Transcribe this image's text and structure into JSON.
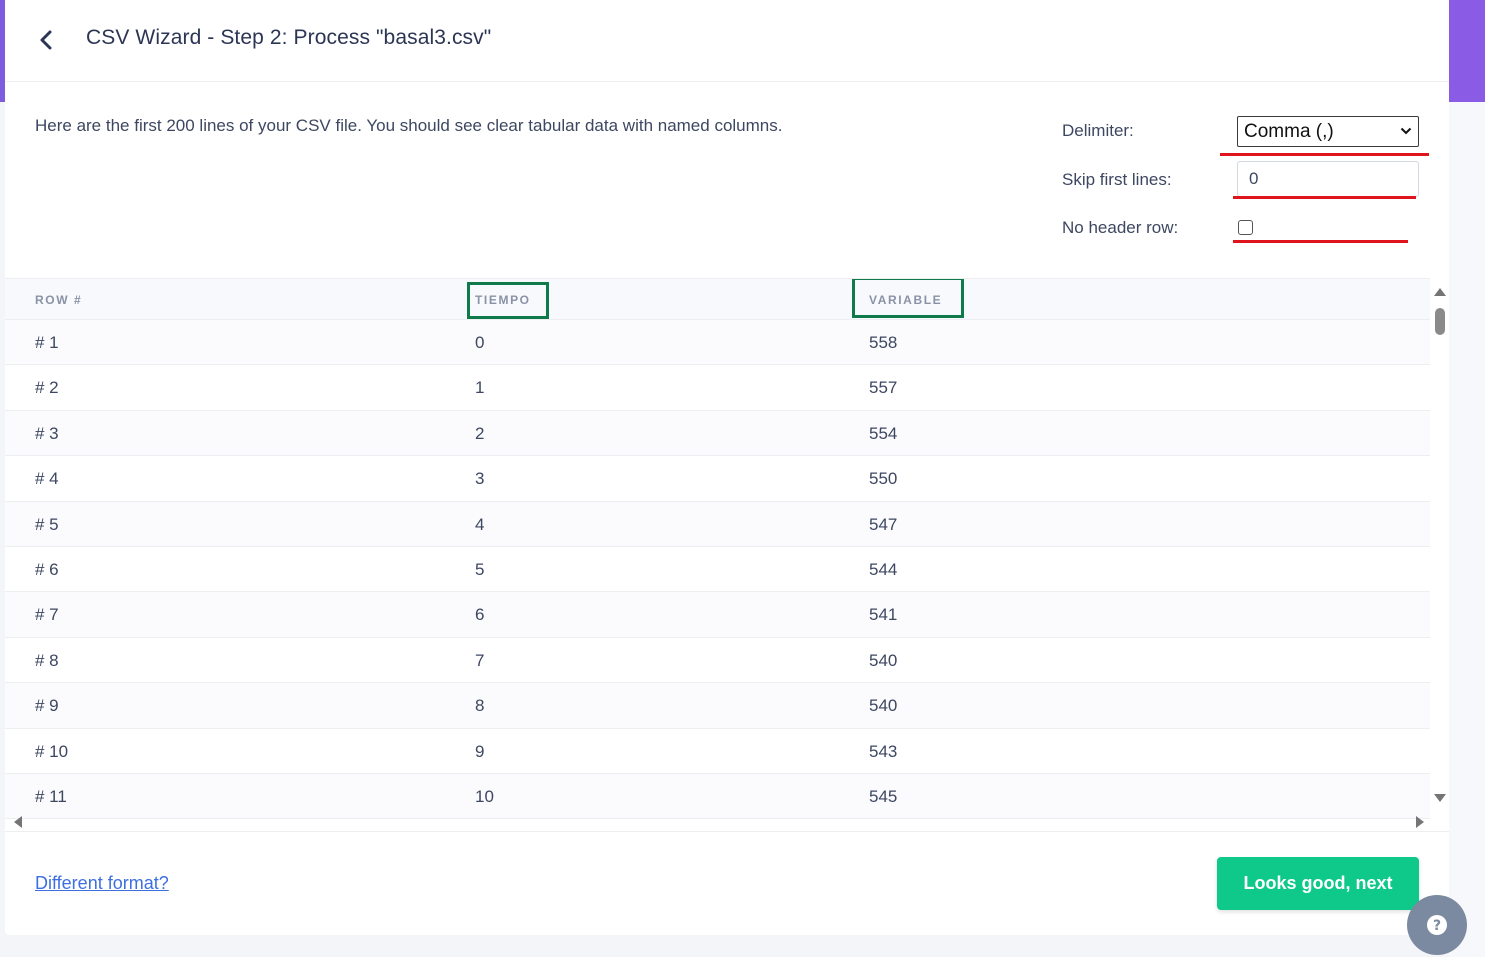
{
  "header": {
    "title": "CSV Wizard - Step 2: Process \"basal3.csv\""
  },
  "intro": "Here are the first 200 lines of your CSV file. You should see clear tabular data with named columns.",
  "options": {
    "delimiter_label": "Delimiter:",
    "delimiter_value": "Comma (,)",
    "skip_label": "Skip first lines:",
    "skip_value": "0",
    "no_header_label": "No header row:",
    "no_header_checked": false
  },
  "table": {
    "columns": [
      "ROW #",
      "TIEMPO",
      "VARIABLE"
    ],
    "rows": [
      [
        "# 1",
        "0",
        "558"
      ],
      [
        "# 2",
        "1",
        "557"
      ],
      [
        "# 3",
        "2",
        "554"
      ],
      [
        "# 4",
        "3",
        "550"
      ],
      [
        "# 5",
        "4",
        "547"
      ],
      [
        "# 6",
        "5",
        "544"
      ],
      [
        "# 7",
        "6",
        "541"
      ],
      [
        "# 8",
        "7",
        "540"
      ],
      [
        "# 9",
        "8",
        "540"
      ],
      [
        "# 10",
        "9",
        "543"
      ],
      [
        "# 11",
        "10",
        "545"
      ]
    ]
  },
  "footer": {
    "different_format_link": "Different format?",
    "next_button": "Looks good, next"
  },
  "icons": {
    "back": "chevron-left-icon",
    "help": "question-icon",
    "select_caret": "chevron-down-icon"
  },
  "colors": {
    "accent_green": "#0ec98a",
    "annotation_red": "#e0141c",
    "annotation_green": "#0f7a4a",
    "header_purple": "#7f5be0",
    "link_blue": "#3d6fe0"
  }
}
